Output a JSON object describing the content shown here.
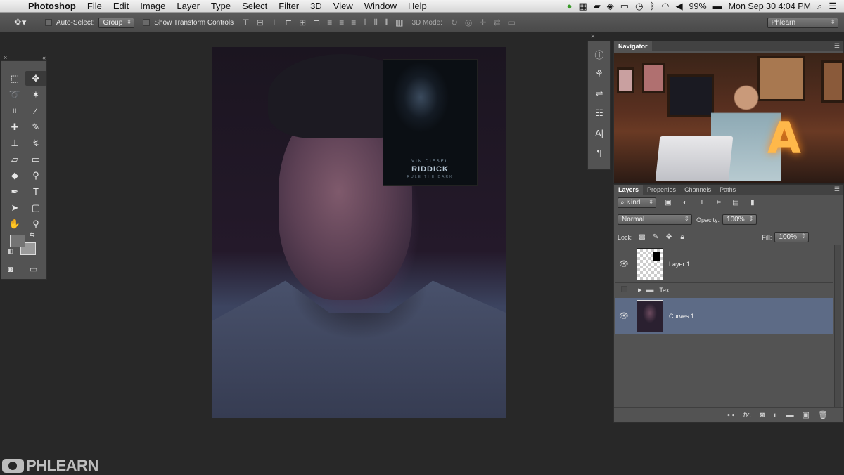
{
  "menubar": {
    "items": [
      "Photoshop",
      "File",
      "Edit",
      "Image",
      "Layer",
      "Type",
      "Select",
      "Filter",
      "3D",
      "View",
      "Window",
      "Help"
    ],
    "battery": "99%",
    "datetime": "Mon Sep 30  4:04 PM"
  },
  "options": {
    "auto_select_label": "Auto-Select:",
    "auto_select_value": "Group",
    "show_transform_label": "Show Transform Controls",
    "mode_label": "3D Mode:",
    "workspace": "Phlearn"
  },
  "poster": {
    "line1": "VIN DIESEL",
    "line2": "RIDDICK",
    "line3": "RULE THE DARK"
  },
  "navigator": {
    "tab": "Navigator"
  },
  "layers": {
    "tabs": [
      "Layers",
      "Properties",
      "Channels",
      "Paths"
    ],
    "filter_value": "Kind",
    "blend_mode": "Normal",
    "opacity_label": "Opacity:",
    "opacity_value": "100%",
    "lock_label": "Lock:",
    "fill_label": "Fill:",
    "fill_value": "100%",
    "items": [
      {
        "name": "Layer 1",
        "visible": true,
        "selected": false,
        "type": "layer"
      },
      {
        "name": "Text",
        "visible": false,
        "selected": false,
        "type": "group"
      },
      {
        "name": "Curves 1",
        "visible": true,
        "selected": true,
        "type": "layer"
      }
    ]
  },
  "watermark": {
    "text": "PHLEARN"
  },
  "colors": {
    "selected_layer": "#5d6b86",
    "panel": "#535353",
    "background": "#282828"
  }
}
